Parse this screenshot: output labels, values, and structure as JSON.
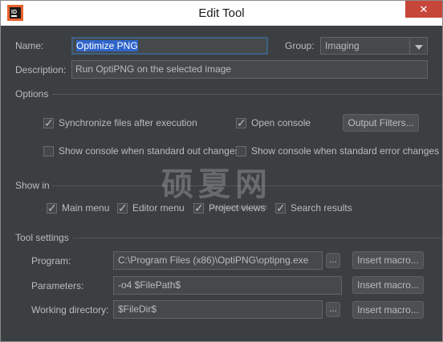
{
  "window": {
    "title": "Edit Tool",
    "close_glyph": "✕",
    "app_icon": "ide-app-icon"
  },
  "general": {
    "name_label": "Name:",
    "name_value": "Optimize PNG",
    "group_label": "Group:",
    "group_value": "Imaging",
    "description_label": "Description:",
    "description_value": "Run OptiPNG on the selected image"
  },
  "options": {
    "title": "Options",
    "sync_files": {
      "label": "Synchronize files after execution",
      "checked": true
    },
    "open_console": {
      "label": "Open console",
      "checked": true
    },
    "output_filters_label": "Output Filters...",
    "show_console_stdout": {
      "label": "Show console when standard out changes",
      "checked": false
    },
    "show_console_stderr": {
      "label": "Show console when standard error changes",
      "checked": false
    }
  },
  "show_in": {
    "title": "Show in",
    "main_menu": {
      "label": "Main menu",
      "checked": true
    },
    "editor_menu": {
      "label": "Editor menu",
      "checked": true
    },
    "project_views": {
      "label": "Project views",
      "checked": true
    },
    "search_results": {
      "label": "Search results",
      "checked": true
    }
  },
  "tool_settings": {
    "title": "Tool settings",
    "program_label": "Program:",
    "program_value": "C:\\Program Files (x86)\\OptiPNG\\optipng.exe",
    "parameters_label": "Parameters:",
    "parameters_value": "-o4 $FilePath$",
    "workdir_label": "Working directory:",
    "workdir_value": "$FileDir$",
    "browse_label": "...",
    "insert_macro_label": "Insert macro..."
  },
  "watermark": {
    "text": "硕夏网",
    "subtext": "www.sxiaw.com"
  },
  "colors": {
    "background": "#3c3f41",
    "field": "#45494a",
    "selection": "#2f65ca",
    "close": "#c7463a"
  }
}
